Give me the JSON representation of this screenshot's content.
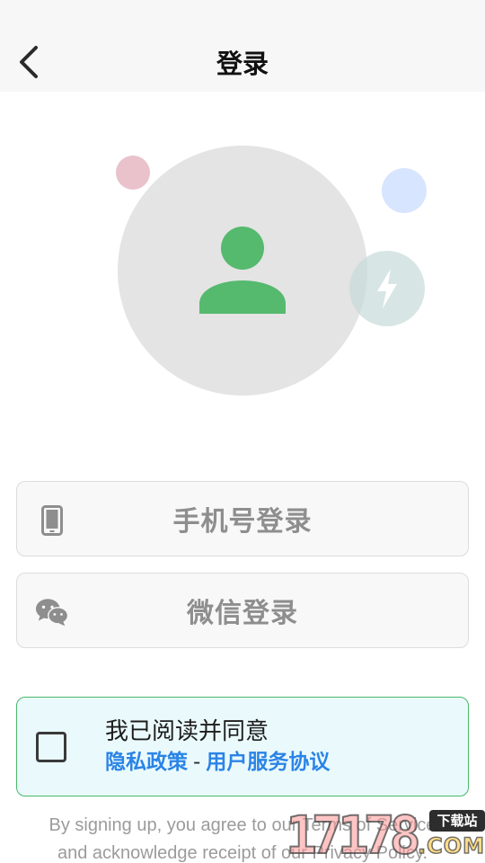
{
  "header": {
    "title": "登录"
  },
  "login_options": {
    "phone_label": "手机号登录",
    "wechat_label": "微信登录"
  },
  "agreement": {
    "text": "我已阅读并同意",
    "privacy_link": "隐私政策",
    "separator": "-",
    "service_link": "用户服务协议"
  },
  "footer": {
    "terms_line1": "By signing up, you agree to our Terms of Service",
    "terms_line2": "and acknowledge receipt of our Privacy Policy."
  },
  "watermark": {
    "badge": "下载站",
    "number": "17178",
    "suffix": ".COM"
  },
  "icons": {
    "back": "chevron-left-icon",
    "avatar": "user-icon",
    "flash": "flash-icon",
    "phone": "phone-icon",
    "wechat": "wechat-icon"
  },
  "colors": {
    "accent_green": "#55b96e",
    "link_blue": "#2b84e6",
    "agree_border": "#49b86a",
    "agree_bg": "#eafafc",
    "avatar_circle": "#e4e4e4"
  }
}
